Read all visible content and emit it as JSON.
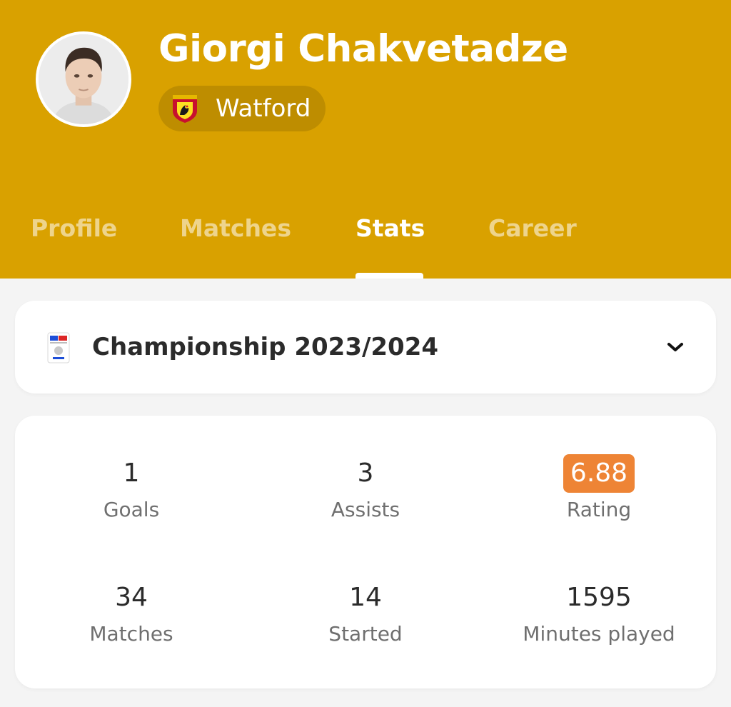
{
  "player": {
    "name": "Giorgi Chakvetadze",
    "team": "Watford"
  },
  "tabs": [
    "Profile",
    "Matches",
    "Stats",
    "Career"
  ],
  "active_tab": "Stats",
  "league": {
    "name": "Championship 2023/2024"
  },
  "stats": [
    {
      "value": "1",
      "label": "Goals"
    },
    {
      "value": "3",
      "label": "Assists"
    },
    {
      "value": "6.88",
      "label": "Rating"
    },
    {
      "value": "34",
      "label": "Matches"
    },
    {
      "value": "14",
      "label": "Started"
    },
    {
      "value": "1595",
      "label": "Minutes played"
    }
  ],
  "colors": {
    "header": "#d9a100",
    "rating_badge": "#ee8435",
    "background": "#f4f4f4"
  },
  "icons": {
    "avatar": "player-photo",
    "team": "watford-crest-icon",
    "league": "efl-championship-logo-icon",
    "dropdown": "chevron-down-icon"
  }
}
